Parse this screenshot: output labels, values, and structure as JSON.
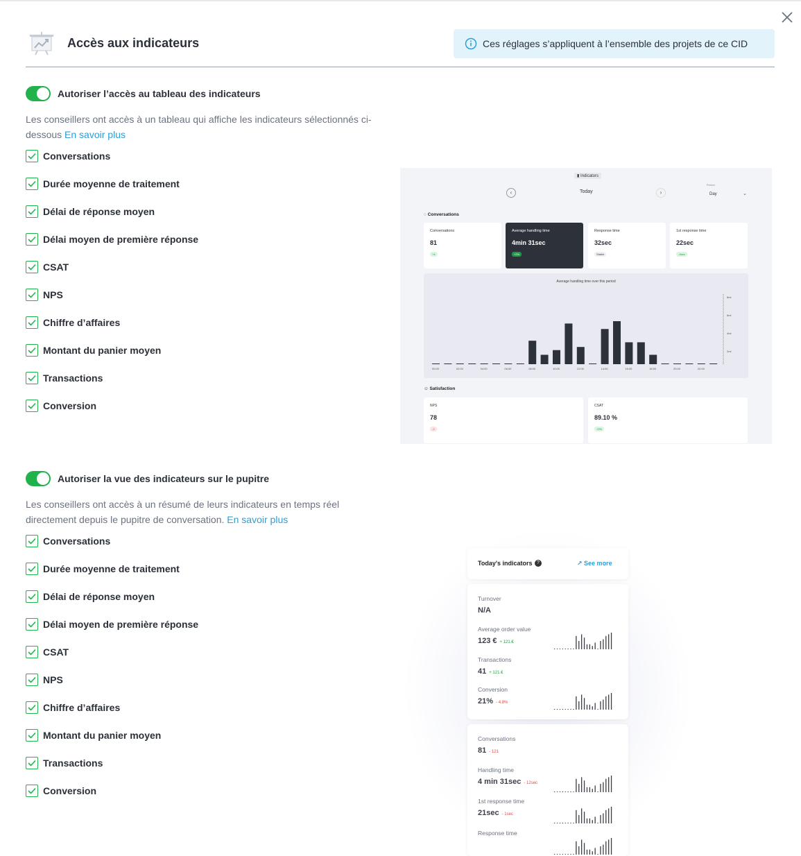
{
  "header": {
    "title": "Accès aux indicateurs",
    "info": "Ces réglages s’appliquent à l’ensemble des projets de ce CID"
  },
  "section1": {
    "toggle_label": "Autoriser l’accès au tableau des indicateurs",
    "desc": "Les conseillers ont accès à un tableau qui affiche les indicateurs sélectionnés ci-dessous",
    "link": "En savoir plus",
    "items": [
      "Conversations",
      "Durée moyenne de traitement",
      "Délai de réponse moyen",
      "Délai moyen de première réponse",
      "CSAT",
      "NPS",
      "Chiffre d’affaires",
      "Montant du panier moyen",
      "Transactions",
      "Conversion"
    ]
  },
  "section2": {
    "toggle_label": "Autoriser la vue des indicateurs sur le pupitre",
    "desc": "Les conseillers ont accès à un résumé de leurs indicateurs en temps réel directement depuis le pupitre de conversation.",
    "link": "En savoir plus",
    "items": [
      "Conversations",
      "Durée moyenne de traitement",
      "Délai de réponse moyen",
      "Délai moyen de première réponse",
      "CSAT",
      "NPS",
      "Chiffre d’affaires",
      "Montant du panier moyen",
      "Transactions",
      "Conversion"
    ]
  },
  "preview1": {
    "tab": "Indicators",
    "today": "Today",
    "period_label": "Period",
    "period_value": "Day",
    "conversations_heading": "Conversations",
    "cards": [
      {
        "label": "Conversations",
        "value": "81",
        "badge": "+4"
      },
      {
        "label": "Average handling time",
        "value": "4min 31sec",
        "badge": "+2%"
      },
      {
        "label": "Response time",
        "value": "32sec",
        "badge": "Stable"
      },
      {
        "label": "1st response time",
        "value": "22sec",
        "badge": "-2sec"
      }
    ],
    "chart_title": "Average handling time over this period",
    "satisfaction_heading": "Satisfaction",
    "sat_cards": [
      {
        "label": "NPS",
        "value": "78",
        "badge": "-2"
      },
      {
        "label": "CSAT",
        "value": "89.10 %",
        "badge": "+2%"
      }
    ]
  },
  "preview2": {
    "title": "Today's indicators",
    "see_more": "See more",
    "card1": [
      {
        "label": "Turnover",
        "value": "N/A",
        "delta": ""
      },
      {
        "label": "Average order value",
        "value": "123 €",
        "delta": "+ 121.€"
      },
      {
        "label": "Transactions",
        "value": "41",
        "delta": "+ 121.€"
      },
      {
        "label": "Conversion",
        "value": "21%",
        "delta": "- 4.8%"
      }
    ],
    "card2": [
      {
        "label": "Conversations",
        "value": "81",
        "delta": "- 121"
      },
      {
        "label": "Handling time",
        "value": "4 min 31sec",
        "delta": "- 12sec"
      },
      {
        "label": "1st response time",
        "value": "21sec",
        "delta": "- 1sec"
      },
      {
        "label": "Response time",
        "value": "",
        "delta": ""
      }
    ]
  },
  "chart_data": {
    "type": "bar",
    "title": "Average handling time over this period",
    "categories": [
      "00:00",
      "",
      "02:00",
      "",
      "04:00",
      "",
      "06:00",
      "",
      "08:00",
      "",
      "10:00",
      "",
      "12:00",
      "",
      "14:00",
      "",
      "16:00",
      "",
      "18:00",
      "",
      "20:00",
      "",
      "22:00",
      ""
    ],
    "values": [
      0,
      0,
      0,
      0,
      0,
      0,
      0,
      0,
      3,
      1.2,
      1.8,
      5.2,
      2.2,
      0,
      4.5,
      5.5,
      2.8,
      2.8,
      1.2,
      0,
      0,
      0,
      0,
      0
    ],
    "ylabel": "",
    "y_ticks": [
      "8mi",
      "6mi",
      "4mi",
      "2mi"
    ],
    "ylim": [
      0,
      8
    ]
  },
  "colors": {
    "green": "#22b24c",
    "link": "#2a9fd8",
    "info_bg": "#e3f3fb",
    "dark_card": "#2d313a"
  }
}
